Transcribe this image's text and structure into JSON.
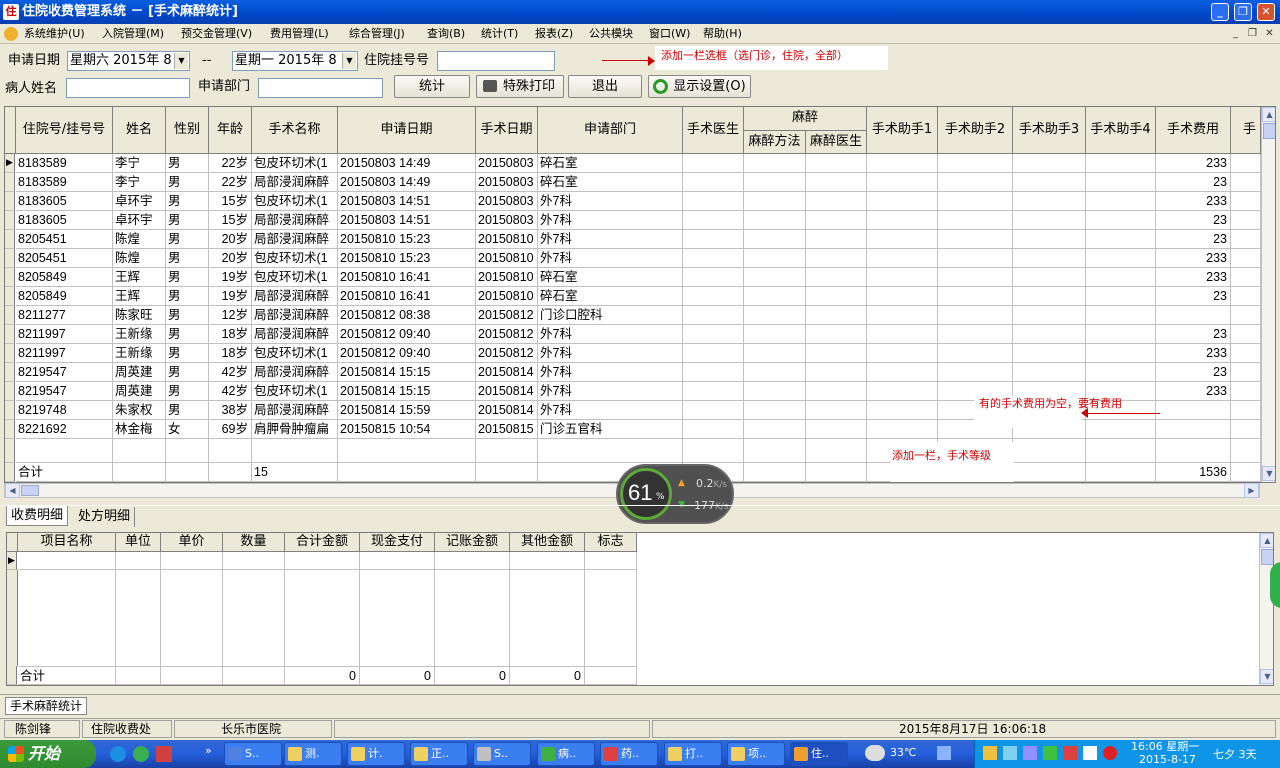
{
  "window": {
    "title": "住院收费管理系统 － [手术麻醉统计]",
    "icon": "app-icon"
  },
  "menu": [
    "系统维护(U)",
    "入院管理(M)",
    "预交金管理(V)",
    "费用管理(L)",
    "综合管理(J)",
    "查询(B)",
    "统计(T)",
    "报表(Z)",
    "公共模块",
    "窗口(W)",
    "帮助(H)"
  ],
  "filter": {
    "apply_date_label": "申请日期",
    "start_date": "星期六 2015年 8",
    "separator": "--",
    "end_date": "星期一 2015年 8",
    "hospital_no_label": "住院挂号号",
    "hospital_no_value": "",
    "patient_name_label": "病人姓名",
    "patient_name_value": "",
    "dept_label": "申请部门",
    "dept_value": "",
    "btn_stat": "统计",
    "btn_print": "特殊打印",
    "btn_exit": "退出",
    "btn_display": "显示设置(O)"
  },
  "annotations": {
    "note1": "添加一栏选框（选门诊，住院，全部）",
    "note2": "有的手术费用为空，要有费用",
    "note3": "添加一栏，手术等级"
  },
  "grid": {
    "headers": {
      "hosp_no": "住院号/挂号号",
      "name": "姓名",
      "sex": "性别",
      "age": "年龄",
      "op_name": "手术名称",
      "apply_date": "申请日期",
      "op_date": "手术日期",
      "dept": "申请部门",
      "surgeon": "手术医生",
      "anesthesia": "麻醉",
      "anes_method": "麻醉方法",
      "anes_doctor": "麻醉医生",
      "asst1": "手术助手1",
      "asst2": "手术助手2",
      "asst3": "手术助手3",
      "asst4": "手术助手4",
      "fee": "手术费用",
      "more": "手"
    },
    "rows": [
      {
        "no": "8183589",
        "name": "李宁",
        "sex": "男",
        "age": "22岁",
        "op": "包皮环切术(1",
        "apply": "20150803 14:49",
        "opdate": "20150803",
        "dept": "碎石室",
        "fee": "233"
      },
      {
        "no": "8183589",
        "name": "李宁",
        "sex": "男",
        "age": "22岁",
        "op": "局部浸润麻醉",
        "apply": "20150803 14:49",
        "opdate": "20150803",
        "dept": "碎石室",
        "fee": "23"
      },
      {
        "no": "8183605",
        "name": "卓环宇",
        "sex": "男",
        "age": "15岁",
        "op": "包皮环切术(1",
        "apply": "20150803 14:51",
        "opdate": "20150803",
        "dept": "外7科",
        "fee": "233"
      },
      {
        "no": "8183605",
        "name": "卓环宇",
        "sex": "男",
        "age": "15岁",
        "op": "局部浸润麻醉",
        "apply": "20150803 14:51",
        "opdate": "20150803",
        "dept": "外7科",
        "fee": "23"
      },
      {
        "no": "8205451",
        "name": "陈煌",
        "sex": "男",
        "age": "20岁",
        "op": "局部浸润麻醉",
        "apply": "20150810 15:23",
        "opdate": "20150810",
        "dept": "外7科",
        "fee": "23"
      },
      {
        "no": "8205451",
        "name": "陈煌",
        "sex": "男",
        "age": "20岁",
        "op": "包皮环切术(1",
        "apply": "20150810 15:23",
        "opdate": "20150810",
        "dept": "外7科",
        "fee": "233"
      },
      {
        "no": "8205849",
        "name": "王辉",
        "sex": "男",
        "age": "19岁",
        "op": "包皮环切术(1",
        "apply": "20150810 16:41",
        "opdate": "20150810",
        "dept": "碎石室",
        "fee": "233"
      },
      {
        "no": "8205849",
        "name": "王辉",
        "sex": "男",
        "age": "19岁",
        "op": "局部浸润麻醉",
        "apply": "20150810 16:41",
        "opdate": "20150810",
        "dept": "碎石室",
        "fee": "23"
      },
      {
        "no": "8211277",
        "name": "陈家旺",
        "sex": "男",
        "age": "12岁",
        "op": "局部浸润麻醉",
        "apply": "20150812 08:38",
        "opdate": "20150812",
        "dept": "门诊口腔科",
        "fee": ""
      },
      {
        "no": "8211997",
        "name": "王新缘",
        "sex": "男",
        "age": "18岁",
        "op": "局部浸润麻醉",
        "apply": "20150812 09:40",
        "opdate": "20150812",
        "dept": "外7科",
        "fee": "23"
      },
      {
        "no": "8211997",
        "name": "王新缘",
        "sex": "男",
        "age": "18岁",
        "op": "包皮环切术(1",
        "apply": "20150812 09:40",
        "opdate": "20150812",
        "dept": "外7科",
        "fee": "233"
      },
      {
        "no": "8219547",
        "name": "周英建",
        "sex": "男",
        "age": "42岁",
        "op": "局部浸润麻醉",
        "apply": "20150814 15:15",
        "opdate": "20150814",
        "dept": "外7科",
        "fee": "23"
      },
      {
        "no": "8219547",
        "name": "周英建",
        "sex": "男",
        "age": "42岁",
        "op": "包皮环切术(1",
        "apply": "20150814 15:15",
        "opdate": "20150814",
        "dept": "外7科",
        "fee": "233"
      },
      {
        "no": "8219748",
        "name": "朱家权",
        "sex": "男",
        "age": "38岁",
        "op": "局部浸润麻醉",
        "apply": "20150814 15:59",
        "opdate": "20150814",
        "dept": "外7科",
        "fee": ""
      },
      {
        "no": "8221692",
        "name": "林金梅",
        "sex": "女",
        "age": "69岁",
        "op": "肩胛骨肿瘤扁",
        "apply": "20150815 10:54",
        "opdate": "20150815",
        "dept": "门诊五官科",
        "fee": ""
      }
    ],
    "total_label": "合计",
    "total_count": "15",
    "total_fee": "1536"
  },
  "overlay": {
    "percent": "61",
    "percent_sign": "%",
    "up": "0.2",
    "up_unit": "K/s",
    "down": "177",
    "down_unit": "K/s"
  },
  "tabs": {
    "fee_detail": "收费明细",
    "rx_detail": "处方明细"
  },
  "detail": {
    "headers": [
      "项目名称",
      "单位",
      "单价",
      "数量",
      "合计金额",
      "现金支付",
      "记账金额",
      "其他金额",
      "标志"
    ],
    "total_label": "合计",
    "totals": [
      "0",
      "0",
      "0",
      "0"
    ]
  },
  "mdi_tab": "手术麻醉统计",
  "status": {
    "user": "陈剑锋",
    "dept": "住院收费处",
    "hospital": "长乐市医院",
    "datetime": "2015年8月17日 16:06:18"
  },
  "taskbar": {
    "start": "开始",
    "buttons": [
      "S..",
      "测.",
      "计.",
      "正..",
      "S..",
      "病..",
      "药..",
      "打..",
      "项..",
      "住.."
    ],
    "weather": "33℃",
    "clock_time": "16:06 星期一",
    "clock_date": "2015-8-17",
    "festival": "七夕 3天"
  }
}
